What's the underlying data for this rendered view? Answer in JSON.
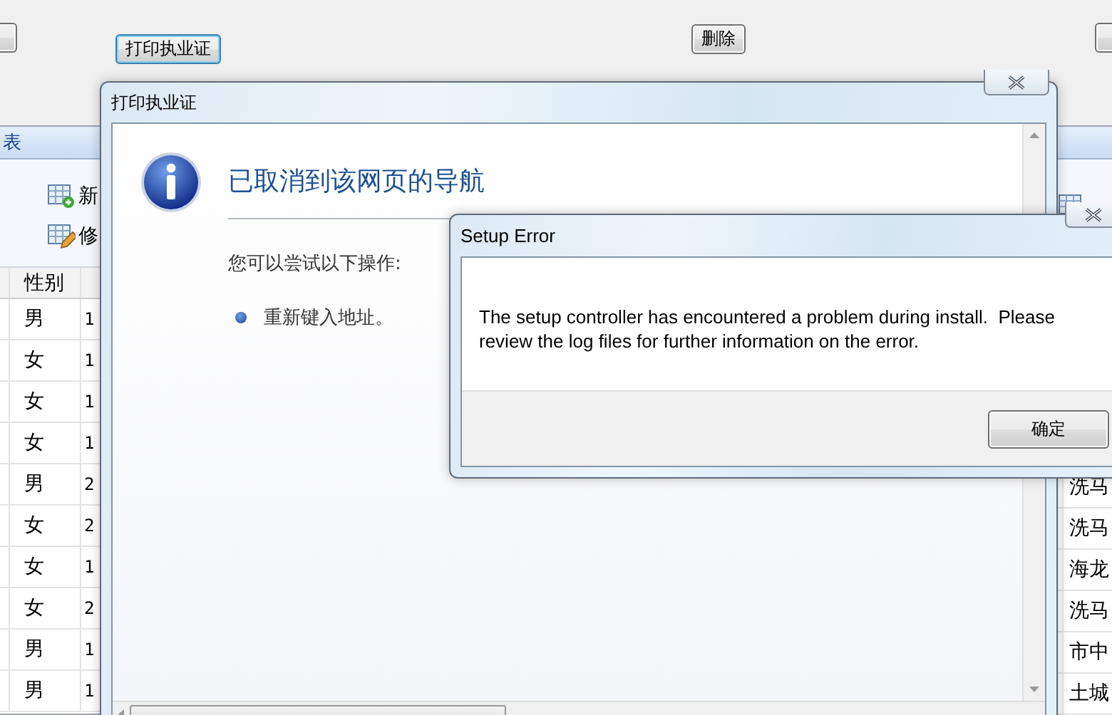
{
  "app": {
    "toolbar_buttons": [
      {
        "label": "打印执业证"
      },
      {
        "label": "删除"
      }
    ],
    "left_panel": {
      "title": "表",
      "actions": [
        {
          "kind": "add",
          "label": "新"
        },
        {
          "kind": "edit",
          "label": "修"
        }
      ],
      "columns": [
        "性别"
      ],
      "rows": [
        {
          "gender": "男",
          "column_3": "1"
        },
        {
          "gender": "女",
          "column_3": "1"
        },
        {
          "gender": "女",
          "column_3": "1"
        },
        {
          "gender": "女",
          "column_3": "1"
        },
        {
          "gender": "男",
          "column_3": "2"
        },
        {
          "gender": "女",
          "column_3": "2"
        },
        {
          "gender": "女",
          "column_3": "1"
        },
        {
          "gender": "女",
          "column_3": "2"
        },
        {
          "gender": "男",
          "column_3": "1"
        },
        {
          "gender": "男",
          "column_3": "1"
        }
      ]
    },
    "right_panel": {
      "cells": [
        "洗马",
        "洗马",
        "海龙",
        "洗马",
        "市中",
        "土城"
      ]
    }
  },
  "browser_dialog": {
    "title": "打印执业证",
    "heading": "已取消到该网页的导航",
    "hint": "您可以尝试以下操作:",
    "suggestions": [
      "重新键入地址。"
    ]
  },
  "error_dialog": {
    "title": "Setup Error",
    "message": "The setup controller has encountered a problem during install.  Please review the log files for further information on the error.",
    "buttons": [
      "确定"
    ]
  }
}
